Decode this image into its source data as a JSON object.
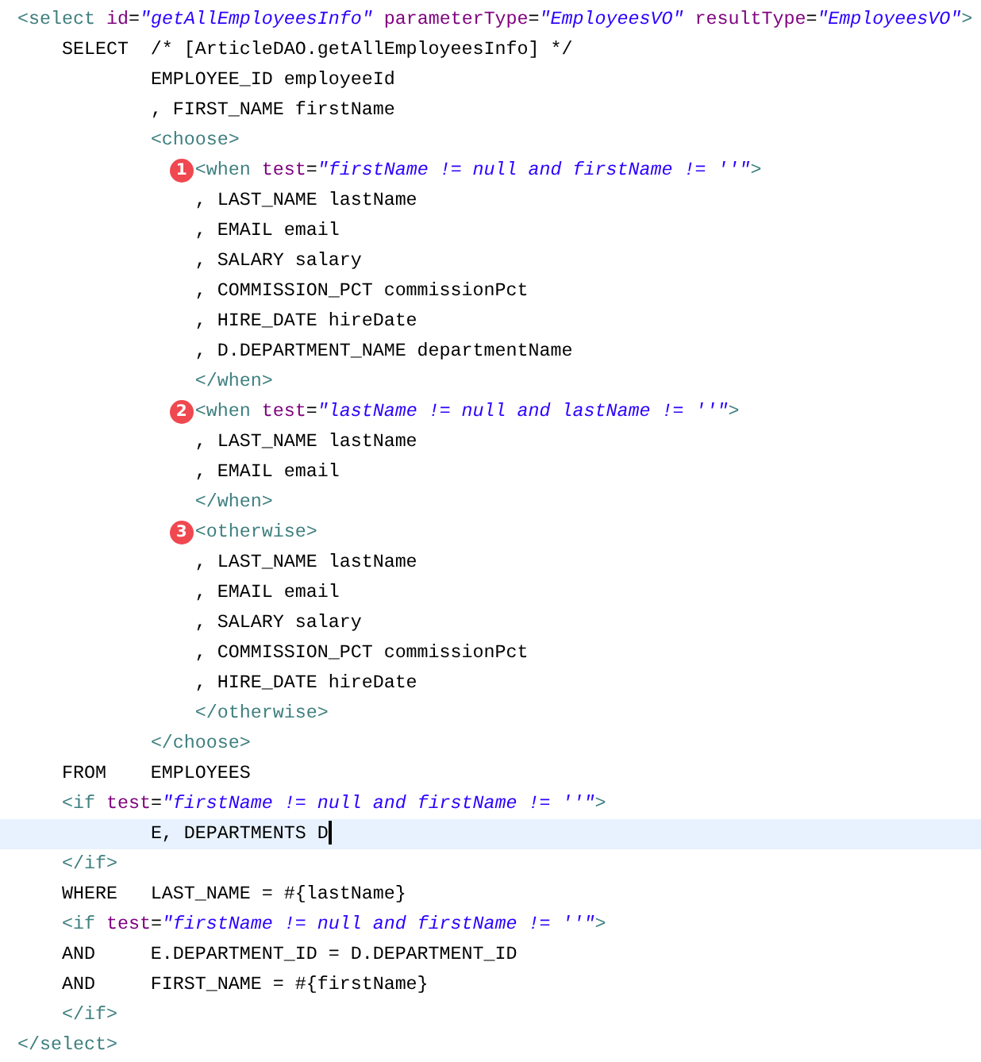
{
  "editor": {
    "lines": [
      {
        "tokens": [
          {
            "kind": "tag",
            "text": "<select "
          },
          {
            "kind": "attr",
            "text": "id"
          },
          {
            "kind": "plain",
            "text": "="
          },
          {
            "kind": "value",
            "text": "\"getAllEmployeesInfo\" "
          },
          {
            "kind": "attr",
            "text": "parameterType"
          },
          {
            "kind": "plain",
            "text": "="
          },
          {
            "kind": "value",
            "text": "\"EmployeesVO\" "
          },
          {
            "kind": "attr",
            "text": "resultType"
          },
          {
            "kind": "plain",
            "text": "="
          },
          {
            "kind": "value",
            "text": "\"EmployeesVO\""
          },
          {
            "kind": "tag",
            "text": ">"
          }
        ],
        "children": [
          {
            "tokens": [
              {
                "kind": "plain",
                "text": "SELECT  /* [ArticleDAO.getAllEmployeesInfo] */"
              }
            ],
            "children": [
              {
                "tokens": [
                  {
                    "kind": "plain",
                    "text": "EMPLOYEE_ID employeeId"
                  }
                ]
              },
              {
                "tokens": [
                  {
                    "kind": "plain",
                    "text": ", FIRST_NAME firstName"
                  }
                ]
              },
              {
                "tokens": [
                  {
                    "kind": "tag",
                    "text": "<choose>"
                  }
                ],
                "children": [
                  {
                    "badge": "1",
                    "tokens": [
                      {
                        "kind": "tag",
                        "text": "<when "
                      },
                      {
                        "kind": "attr",
                        "text": "test"
                      },
                      {
                        "kind": "plain",
                        "text": "="
                      },
                      {
                        "kind": "value",
                        "text": "\"firstName != null and firstName != ''\""
                      },
                      {
                        "kind": "tag",
                        "text": ">"
                      }
                    ]
                  },
                  {
                    "tokens": [
                      {
                        "kind": "plain",
                        "text": ", LAST_NAME lastName"
                      }
                    ]
                  },
                  {
                    "tokens": [
                      {
                        "kind": "plain",
                        "text": ", EMAIL email"
                      }
                    ]
                  },
                  {
                    "tokens": [
                      {
                        "kind": "plain",
                        "text": ", SALARY salary"
                      }
                    ]
                  },
                  {
                    "tokens": [
                      {
                        "kind": "plain",
                        "text": ", COMMISSION_PCT commissionPct"
                      }
                    ]
                  },
                  {
                    "tokens": [
                      {
                        "kind": "plain",
                        "text": ", HIRE_DATE hireDate"
                      }
                    ]
                  },
                  {
                    "tokens": [
                      {
                        "kind": "plain",
                        "text": ", D.DEPARTMENT_NAME departmentName"
                      }
                    ]
                  },
                  {
                    "tokens": [
                      {
                        "kind": "tag",
                        "text": "</when>"
                      }
                    ]
                  },
                  {
                    "badge": "2",
                    "tokens": [
                      {
                        "kind": "tag",
                        "text": "<when "
                      },
                      {
                        "kind": "attr",
                        "text": "test"
                      },
                      {
                        "kind": "plain",
                        "text": "="
                      },
                      {
                        "kind": "value",
                        "text": "\"lastName != null and lastName != ''\""
                      },
                      {
                        "kind": "tag",
                        "text": ">"
                      }
                    ]
                  },
                  {
                    "tokens": [
                      {
                        "kind": "plain",
                        "text": ", LAST_NAME lastName"
                      }
                    ]
                  },
                  {
                    "tokens": [
                      {
                        "kind": "plain",
                        "text": ", EMAIL email"
                      }
                    ]
                  },
                  {
                    "tokens": [
                      {
                        "kind": "tag",
                        "text": "</when>"
                      }
                    ]
                  },
                  {
                    "badge": "3",
                    "tokens": [
                      {
                        "kind": "tag",
                        "text": "<otherwise>"
                      }
                    ]
                  },
                  {
                    "tokens": [
                      {
                        "kind": "plain",
                        "text": ", LAST_NAME lastName"
                      }
                    ]
                  },
                  {
                    "tokens": [
                      {
                        "kind": "plain",
                        "text": ", EMAIL email"
                      }
                    ]
                  },
                  {
                    "tokens": [
                      {
                        "kind": "plain",
                        "text": ", SALARY salary"
                      }
                    ]
                  },
                  {
                    "tokens": [
                      {
                        "kind": "plain",
                        "text": ", COMMISSION_PCT commissionPct"
                      }
                    ]
                  },
                  {
                    "tokens": [
                      {
                        "kind": "plain",
                        "text": ", HIRE_DATE hireDate"
                      }
                    ]
                  },
                  {
                    "tokens": [
                      {
                        "kind": "tag",
                        "text": "</otherwise>"
                      }
                    ]
                  }
                ]
              },
              {
                "tokens": [
                  {
                    "kind": "tag",
                    "text": "</choose>"
                  }
                ]
              }
            ]
          },
          {
            "tokens": [
              {
                "kind": "plain",
                "text": "FROM    EMPLOYEES"
              }
            ]
          },
          {
            "tokens": [
              {
                "kind": "tag",
                "text": "<if "
              },
              {
                "kind": "attr",
                "text": "test"
              },
              {
                "kind": "plain",
                "text": "="
              },
              {
                "kind": "value",
                "text": "\"firstName != null and firstName != ''\""
              },
              {
                "kind": "tag",
                "text": ">"
              }
            ],
            "children": [
              {
                "current": true,
                "tokens": [
                  {
                    "kind": "plain",
                    "text": "E, DEPARTMENTS D"
                  }
                ]
              }
            ]
          },
          {
            "tokens": [
              {
                "kind": "tag",
                "text": "</if>"
              }
            ]
          },
          {
            "tokens": [
              {
                "kind": "plain",
                "text": "WHERE   LAST_NAME = #{lastName}"
              }
            ]
          },
          {
            "tokens": [
              {
                "kind": "tag",
                "text": "<if "
              },
              {
                "kind": "attr",
                "text": "test"
              },
              {
                "kind": "plain",
                "text": "="
              },
              {
                "kind": "value",
                "text": "\"firstName != null and firstName != ''\""
              },
              {
                "kind": "tag",
                "text": ">"
              }
            ]
          },
          {
            "tokens": [
              {
                "kind": "plain",
                "text": "AND     E.DEPARTMENT_ID = D.DEPARTMENT_ID"
              }
            ]
          },
          {
            "tokens": [
              {
                "kind": "plain",
                "text": "AND     FIRST_NAME = #{firstName}"
              }
            ]
          },
          {
            "tokens": [
              {
                "kind": "tag",
                "text": "</if>"
              }
            ]
          }
        ]
      },
      {
        "tokens": [
          {
            "kind": "tag",
            "text": "</select>"
          }
        ]
      }
    ]
  }
}
